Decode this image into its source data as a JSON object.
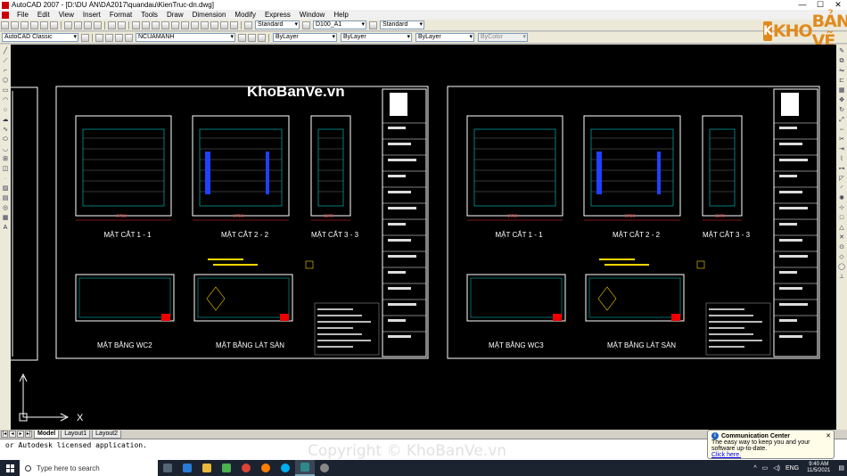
{
  "window": {
    "title": "AutoCAD 2007 - [D:\\DU ÁN\\DA2017\\quandau\\KienTruc-dn.dwg]",
    "controls": [
      "—",
      "☐",
      "✕"
    ]
  },
  "menu": [
    "File",
    "Edit",
    "View",
    "Insert",
    "Format",
    "Tools",
    "Draw",
    "Dimension",
    "Modify",
    "Express",
    "Window",
    "Help"
  ],
  "toolbar": {
    "text_style": "Standard",
    "dim_style": "D100_A1",
    "table_style": "Standard",
    "workspace": "AutoCAD Classic",
    "layer": "NCUAMANH",
    "color": "ByLayer",
    "linetype": "ByLayer",
    "lineweight": "ByLayer",
    "plotstyle": "ByColor"
  },
  "logo": {
    "brand_left": "KHO",
    "brand_right": "BẢN VẼ",
    "color": "#e08a1e"
  },
  "drawing": {
    "watermark": "KhoBanVe.vn",
    "sheets": [
      {
        "sections": [
          "MẶT CẮT 1 - 1",
          "MẶT CẮT 2 - 2",
          "MẶT CẮT 3 - 3"
        ],
        "plans": [
          "MẶT BẰNG WC2",
          "MẶT BẰNG LÁT SÀN"
        ],
        "dims": [
          "2710",
          "2710",
          "1170"
        ]
      },
      {
        "sections": [
          "MẶT CẮT 1 - 1",
          "MẶT CẮT 2 - 2",
          "MẶT CẮT 3 - 3"
        ],
        "plans": [
          "MẶT BẰNG WC3",
          "MẶT BẰNG LÁT SÀN"
        ],
        "dims": [
          "2710",
          "2710",
          "1170"
        ]
      }
    ]
  },
  "tabs": [
    {
      "label": "Model",
      "active": true
    },
    {
      "label": "Layout1",
      "active": false
    },
    {
      "label": "Layout2",
      "active": false
    }
  ],
  "command": {
    "line1": "or Autodesk licensed application.",
    "line2": ""
  },
  "comm_center": {
    "title": "Communication Center",
    "message": "The easy way to keep you and your software up-to-date.",
    "link": "Click here."
  },
  "taskbar": {
    "search_placeholder": "Type here to search",
    "language": "ENG",
    "time": "9:40 AM",
    "date": "11/5/2021"
  },
  "footer_watermark": "Copyright © KhoBanVe.vn",
  "colors": {
    "canvas": "#000000",
    "border": "#ffffff",
    "dim": "#ff3030",
    "accent": "#ffd700",
    "cyan": "#00d0d0",
    "blue": "#2040ff"
  }
}
